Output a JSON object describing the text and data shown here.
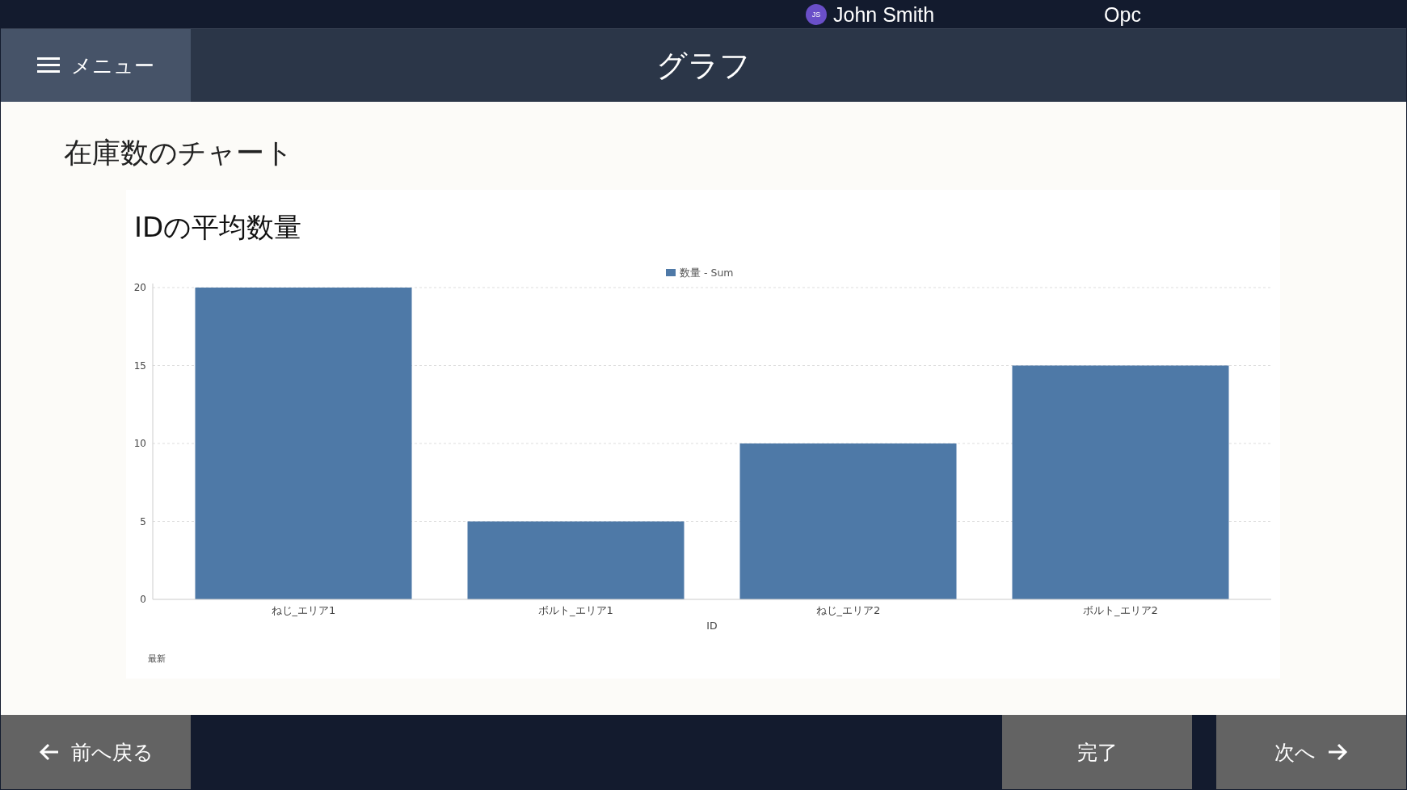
{
  "top_bar": {
    "user": {
      "initials": "JS",
      "name": "John Smith"
    },
    "company": "Opc"
  },
  "header": {
    "menu_label": "メニュー",
    "title": "グラフ"
  },
  "page_title": "在庫数のチャート",
  "chart_card": {
    "title": "IDの平均数量",
    "footnote": "最新",
    "chart_data": {
      "type": "bar",
      "xlabel": "ID",
      "categories": [
        "ねじ_エリア1",
        "ボルト_エリア1",
        "ねじ_エリア2",
        "ボルト_エリア2"
      ],
      "series": [
        {
          "name": "数量 - Sum",
          "color": "#4e79a7",
          "values": [
            20,
            5,
            10,
            15
          ]
        }
      ],
      "ylim": [
        0,
        20
      ],
      "grid": true,
      "yticks": [
        0,
        5,
        10,
        15,
        20
      ]
    }
  },
  "footer": {
    "back": "前へ戻る",
    "done": "完了",
    "next": "次へ"
  }
}
